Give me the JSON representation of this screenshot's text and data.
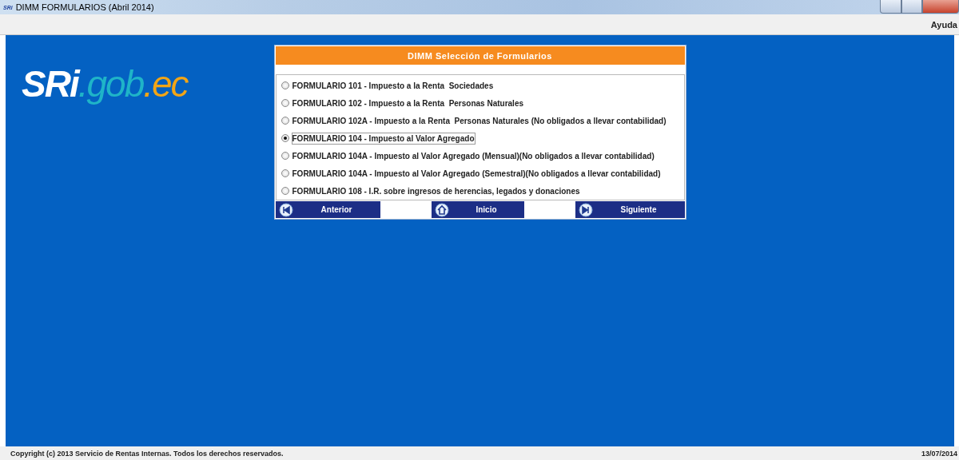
{
  "window": {
    "title": "DIMM FORMULARIOS (Abril 2014)",
    "app_icon_text": "SRi"
  },
  "menu_bar": {
    "items": [
      "Ayuda"
    ]
  },
  "logo": {
    "parts": [
      {
        "text": "SRi",
        "kind": "brand"
      },
      {
        "text": ".gob",
        "kind": "domain"
      },
      {
        "text": ".ec",
        "kind": "tld"
      }
    ]
  },
  "dialog": {
    "title": "DIMM Selección de Formularios",
    "options": [
      {
        "label": "FORMULARIO 101 - Impuesto a la Renta  Sociedades",
        "selected": false
      },
      {
        "label": "FORMULARIO 102 - Impuesto a la Renta  Personas Naturales",
        "selected": false
      },
      {
        "label": "FORMULARIO 102A - Impuesto a la Renta  Personas Naturales (No obligados a llevar contabilidad)",
        "selected": false
      },
      {
        "label": "FORMULARIO 104 - Impuesto al Valor Agregado",
        "selected": true
      },
      {
        "label": "FORMULARIO 104A - Impuesto al Valor Agregado (Mensual)(No obligados a llevar contabilidad)",
        "selected": false
      },
      {
        "label": "FORMULARIO 104A - Impuesto al Valor Agregado (Semestral)(No obligados a llevar contabilidad)",
        "selected": false
      },
      {
        "label": "FORMULARIO 108 - I.R. sobre ingresos de herencias, legados y donaciones",
        "selected": false
      }
    ],
    "buttons": [
      {
        "label": "Anterior",
        "kind": "previous"
      },
      {
        "label": "Inicio",
        "kind": "home"
      },
      {
        "label": "Siguiente",
        "kind": "next"
      }
    ]
  },
  "status_bar": {
    "copyright": "Copyright (c) 2013 Servicio de Rentas Internas. Todos los derechos reservados.",
    "date": "13/07/2014"
  }
}
